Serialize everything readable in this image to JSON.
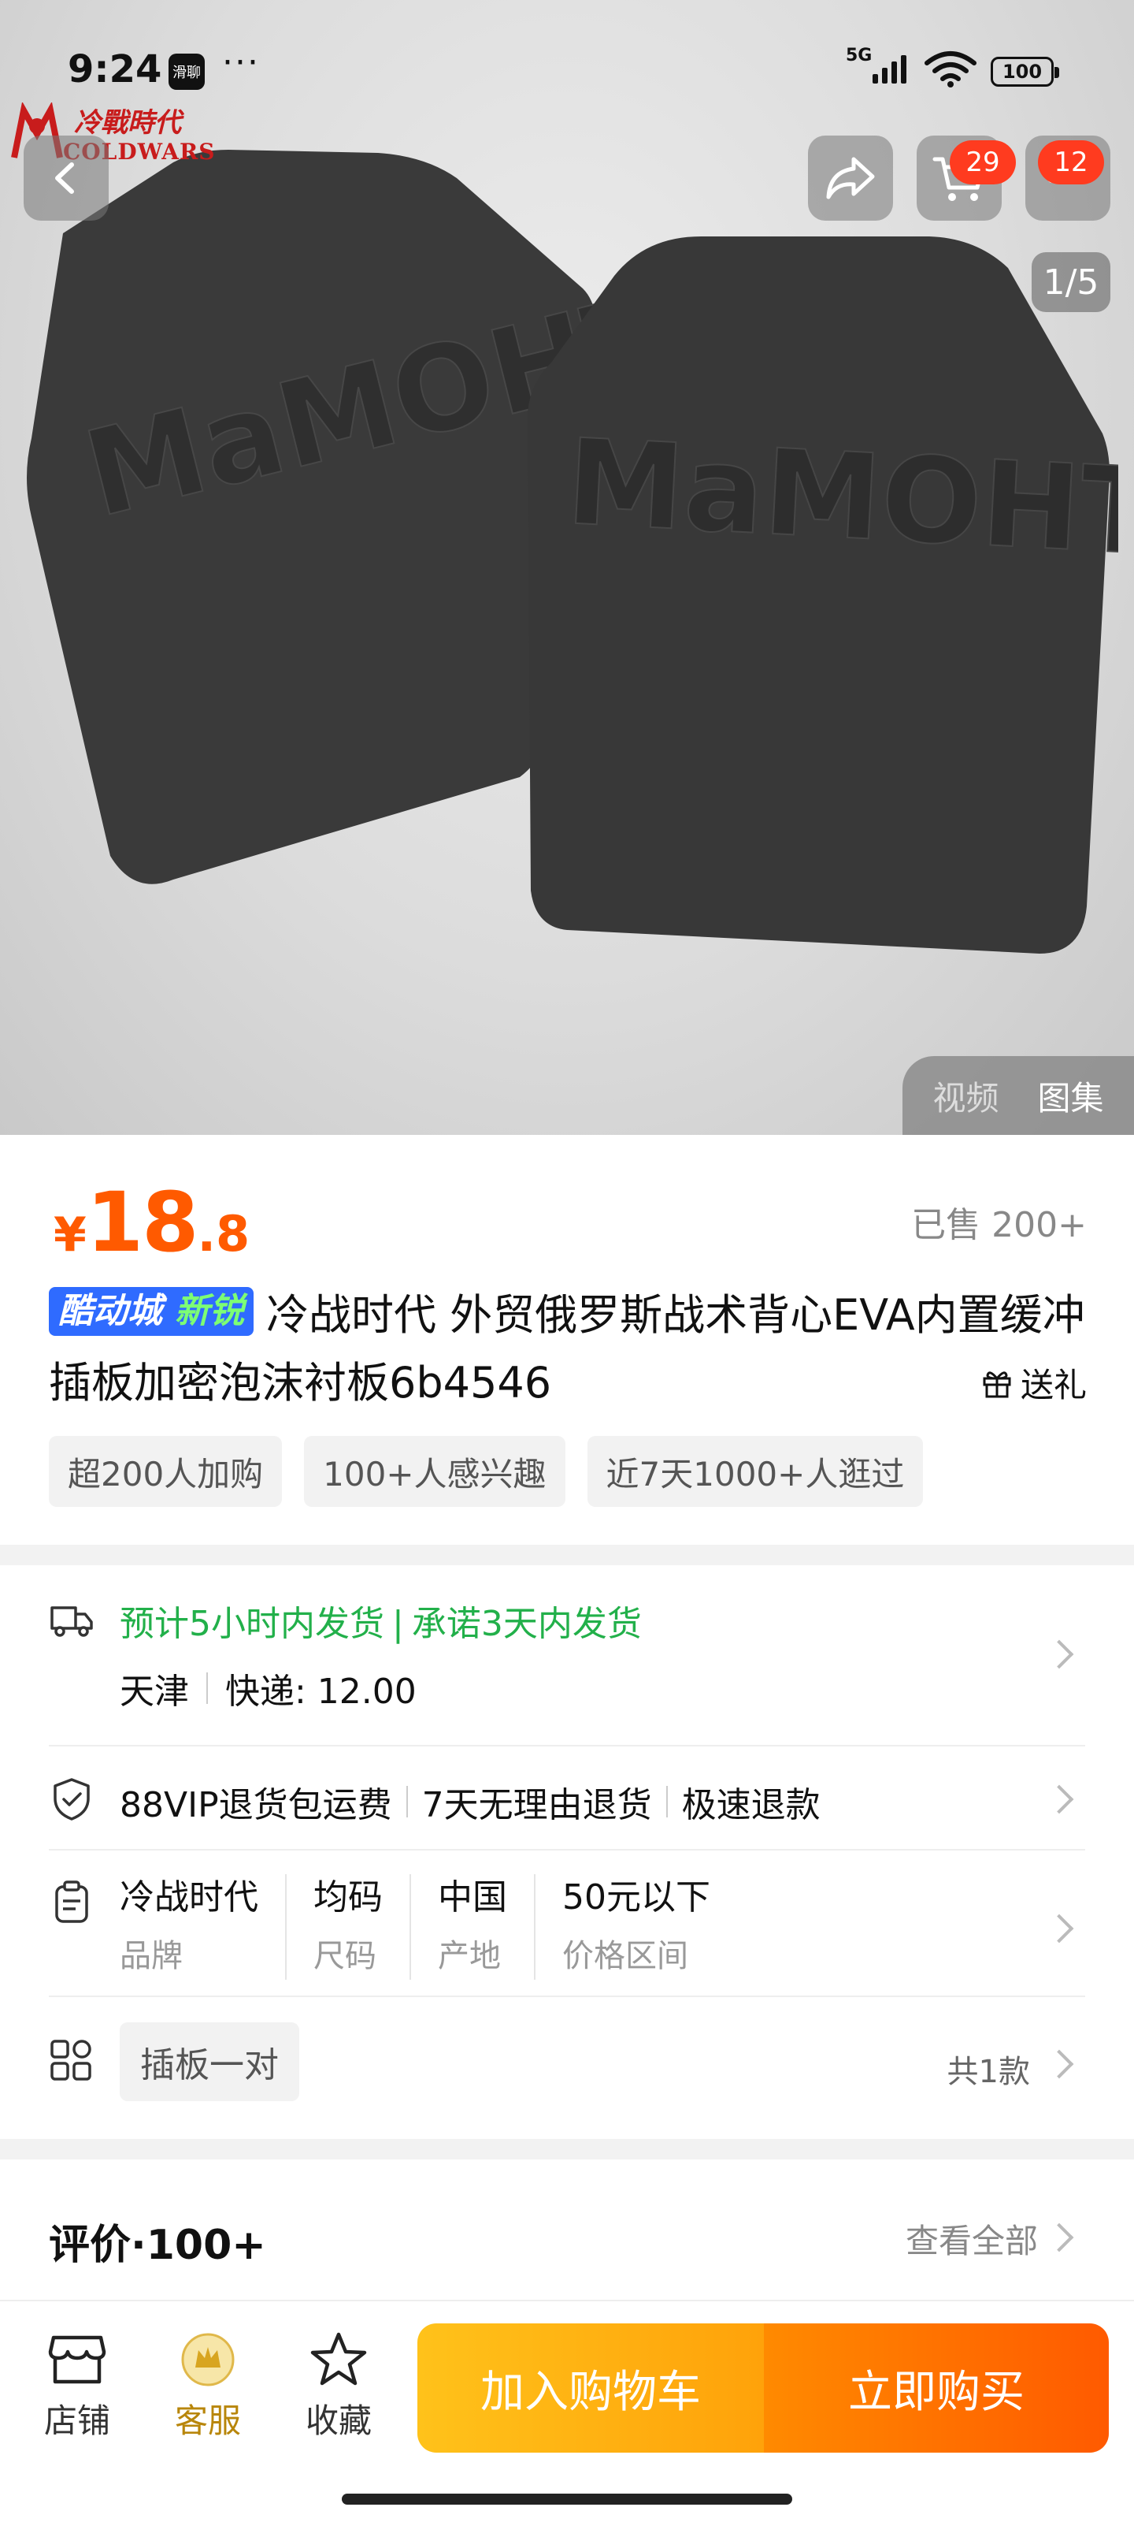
{
  "status_bar": {
    "time": "9:24",
    "app_badge": "滑聊",
    "dots": "···",
    "signal": "5G",
    "battery": "100"
  },
  "watermark": {
    "line1": "冷戰時代",
    "line2": "COLDWARS"
  },
  "top_nav": {
    "cart_count": "29",
    "more_count": "12",
    "image_counter": "1/5"
  },
  "hero": {
    "embossed_text": "MaMOHT"
  },
  "media_tabs": {
    "video": "视频",
    "gallery": "图集"
  },
  "product": {
    "price_currency": "¥",
    "price_int": "18",
    "price_dec": ".8",
    "sold": "已售 200+",
    "tag_a": "酷动城",
    "tag_b": "新锐",
    "title": "冷战时代 外贸俄罗斯战术背心EVA内置缓冲插板加密泡沫衬板6b4546",
    "gift": "送礼",
    "chips": [
      "超200人加购",
      "100+人感兴趣",
      "近7天1000+人逛过"
    ]
  },
  "shipping": {
    "estimate": "预计5小时内发货",
    "sep": "|",
    "promise": "承诺3天内发货",
    "origin": "天津",
    "fee": "快递: 12.00"
  },
  "returns": [
    "88VIP退货包运费",
    "7天无理由退货",
    "极速退款"
  ],
  "attributes": [
    {
      "value": "冷战时代",
      "key": "品牌"
    },
    {
      "value": "均码",
      "key": "尺码"
    },
    {
      "value": "中国",
      "key": "产地"
    },
    {
      "value": "50元以下",
      "key": "价格区间"
    }
  ],
  "variant": {
    "label": "插板一对",
    "count": "共1款"
  },
  "review": {
    "title": "评价·100+",
    "view_all": "查看全部"
  },
  "bottom_bar": {
    "store": "店铺",
    "service": "客服",
    "favorite": "收藏",
    "add_cart": "加入购物车",
    "buy_now": "立即购买"
  },
  "colors": {
    "price": "#ff5a00",
    "green": "#22b04a",
    "cta_yellow": "#ffb000",
    "cta_orange": "#ff5a00",
    "badge_red": "#ff3b1f"
  }
}
